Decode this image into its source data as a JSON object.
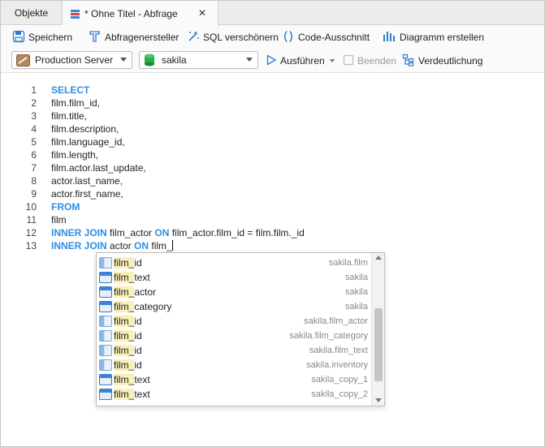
{
  "tabs": {
    "objects_label": "Objekte",
    "query_label": "* Ohne Titel - Abfrage",
    "close_glyph": "✕"
  },
  "toolbar": {
    "save_label": "Speichern",
    "query_builder_label": "Abfragenersteller",
    "beautify_label": "SQL verschönern",
    "snippet_label": "Code-Ausschnitt",
    "chart_label": "Diagramm erstellen"
  },
  "toolbar2": {
    "connection": "Production Server",
    "database": "sakila",
    "run_label": "Ausführen",
    "stop_label": "Beenden",
    "explain_label": "Verdeutlichung"
  },
  "editor": {
    "line_numbers": [
      "1",
      "2",
      "3",
      "4",
      "5",
      "6",
      "7",
      "8",
      "9",
      "10",
      "11",
      "12",
      "13"
    ],
    "lines": {
      "l1_kw": "SELECT",
      "l2": "film.film_id,",
      "l3": "film.title,",
      "l4": "film.description,",
      "l5": "film.language_id,",
      "l6": "film.length,",
      "l7": "film.actor.last_update,",
      "l8": "actor.last_name,",
      "l9": "actor.first_name,",
      "l10_kw": "FROM",
      "l11": "film",
      "l12_kw1": "INNER JOIN",
      "l12_a": " film_actor ",
      "l12_kw2": "ON",
      "l12_b": " film_actor.film_id = film.film._id",
      "l13_kw1": "INNER JOIN",
      "l13_a": " actor ",
      "l13_kw2": "ON",
      "l13_b": " film_"
    }
  },
  "autocomplete": {
    "match_prefix": "film_",
    "items": [
      {
        "prefix": "film_",
        "rest": "id",
        "source": "sakila.film",
        "kind": "column"
      },
      {
        "prefix": "film_",
        "rest": "text",
        "source": "sakila",
        "kind": "table"
      },
      {
        "prefix": "film_",
        "rest": "actor",
        "source": "sakila",
        "kind": "table"
      },
      {
        "prefix": "film_",
        "rest": "category",
        "source": "sakila",
        "kind": "table"
      },
      {
        "prefix": "film_",
        "rest": "id",
        "source": "sakila.film_actor",
        "kind": "column"
      },
      {
        "prefix": "film_",
        "rest": "id",
        "source": "sakila.film_category",
        "kind": "column"
      },
      {
        "prefix": "film_",
        "rest": "id",
        "source": "sakila.film_text",
        "kind": "column"
      },
      {
        "prefix": "film_",
        "rest": "id",
        "source": "sakila.inventory",
        "kind": "column"
      },
      {
        "prefix": "film_",
        "rest": "text",
        "source": "sakila_copy_1",
        "kind": "table"
      },
      {
        "prefix": "film_",
        "rest": "text",
        "source": "sakila_copy_2",
        "kind": "table"
      }
    ]
  },
  "colors": {
    "keyword": "#2f8ee6",
    "highlight": "#fbefb8",
    "db_icon": "#2dab4f"
  }
}
